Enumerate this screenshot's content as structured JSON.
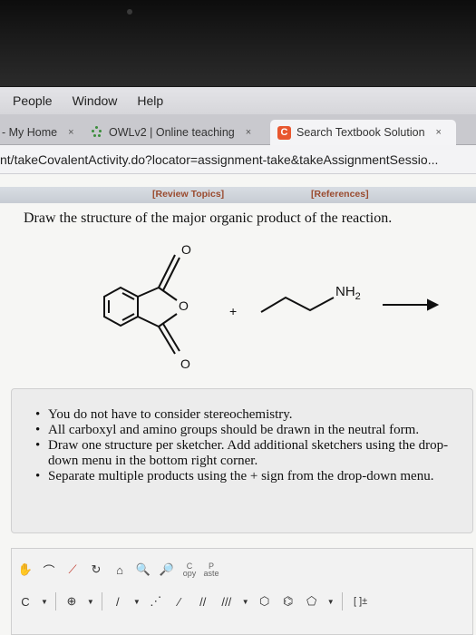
{
  "menu": [
    "People",
    "Window",
    "Help"
  ],
  "tabs": [
    {
      "label": "- My Home",
      "close": "×"
    },
    {
      "label": "OWLv2 | Online teaching",
      "close": "×"
    },
    {
      "label": "Search Textbook Solution",
      "close": "×",
      "favicon": "C"
    }
  ],
  "url": "nt/takeCovalentActivity.do?locator=assignment-take&takeAssignmentSessio...",
  "links": {
    "review_topics": "[Review Topics]",
    "references": "[References]"
  },
  "question": "Draw the structure of the major organic product of the reaction.",
  "reaction": {
    "atom_o_top": "O",
    "atom_o_ring": "O",
    "atom_o_bottom": "O",
    "plus": "+",
    "amine": "NH",
    "amine_sub": "2"
  },
  "instructions": [
    "You do not have to consider stereochemistry.",
    "All carboxyl and amino groups should be drawn in the neutral form.",
    "Draw one structure per sketcher. Add additional sketchers using the drop-down menu in the bottom right corner.",
    "Separate multiple products using the + sign from the drop-down menu."
  ],
  "toolbar": {
    "copy_top": "C",
    "copy_bottom": "opy",
    "paste_top": "P",
    "paste_bottom": "aste",
    "element_c": "C",
    "charge": "⊕",
    "bracket": "[ ]±"
  },
  "colors": {
    "accent_link": "#9a4b2f",
    "favicon_c": "#e8572f"
  }
}
